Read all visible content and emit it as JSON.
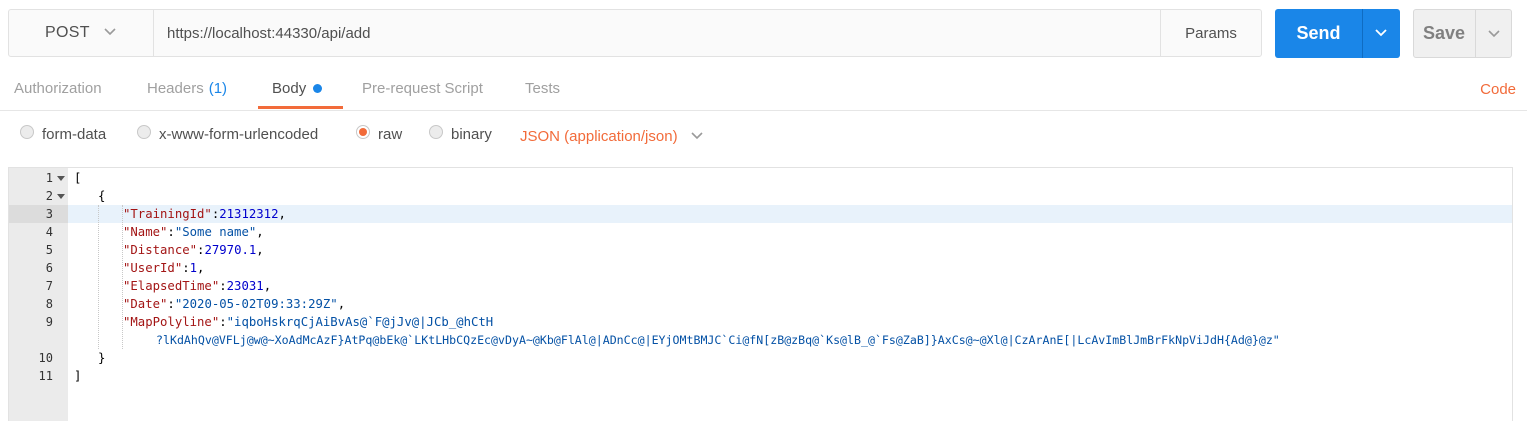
{
  "request": {
    "method": "POST",
    "url": "https://localhost:44330/api/add",
    "params_label": "Params",
    "send_label": "Send",
    "save_label": "Save"
  },
  "tabs": [
    {
      "label": "Authorization"
    },
    {
      "label": "Headers",
      "count": "(1)"
    },
    {
      "label": "Body",
      "active": true
    },
    {
      "label": "Pre-request Script"
    },
    {
      "label": "Tests"
    }
  ],
  "code_link": "Code",
  "body_types": [
    {
      "label": "form-data",
      "checked": false
    },
    {
      "label": "x-www-form-urlencoded",
      "checked": false
    },
    {
      "label": "raw",
      "checked": true
    },
    {
      "label": "binary",
      "checked": false
    }
  ],
  "content_type": "JSON (application/json)",
  "editor": {
    "highlighted_line": 3,
    "lines": [
      {
        "num": "1",
        "text": "["
      },
      {
        "num": "2",
        "text": "{"
      },
      {
        "num": "3",
        "key": "\"TrainingId\"",
        "value": "21312312",
        "vtype": "n",
        "comma": true
      },
      {
        "num": "4",
        "key": "\"Name\"",
        "value": "\"Some name\"",
        "vtype": "s",
        "comma": true
      },
      {
        "num": "5",
        "key": "\"Distance\"",
        "value": "27970.1",
        "vtype": "n",
        "comma": true
      },
      {
        "num": "6",
        "key": "\"UserId\"",
        "value": "1",
        "vtype": "n",
        "comma": true
      },
      {
        "num": "7",
        "key": "\"ElapsedTime\"",
        "value": "23031",
        "vtype": "n",
        "comma": true
      },
      {
        "num": "8",
        "key": "\"Date\"",
        "value": "\"2020-05-02T09:33:29Z\"",
        "vtype": "s",
        "comma": true
      },
      {
        "num": "9",
        "key": "\"MapPolyline\"",
        "value": "\"iqboHskrqCjAiBvAs@`F@jJv@|JCb_@hCtH",
        "vtype": "s",
        "comma": false,
        "wrap": "?lKdAhQv@VFLj@w@~XoAdMcAzF}AtPq@bEk@`LKtLHbCQzEc@vDyA~@Kb@FlAl@|ADnCc@|EYjOMtBMJC`Ci@fN[zB@zBq@`Ks@lB_@`Fs@ZaB]}AxCs@~@Xl@|CzArAnE[|LcAvImBlJmBrFkNpViJdH{Ad@}@z\""
      },
      {
        "num": "10",
        "text": "}"
      },
      {
        "num": "11",
        "text": "]"
      }
    ]
  }
}
